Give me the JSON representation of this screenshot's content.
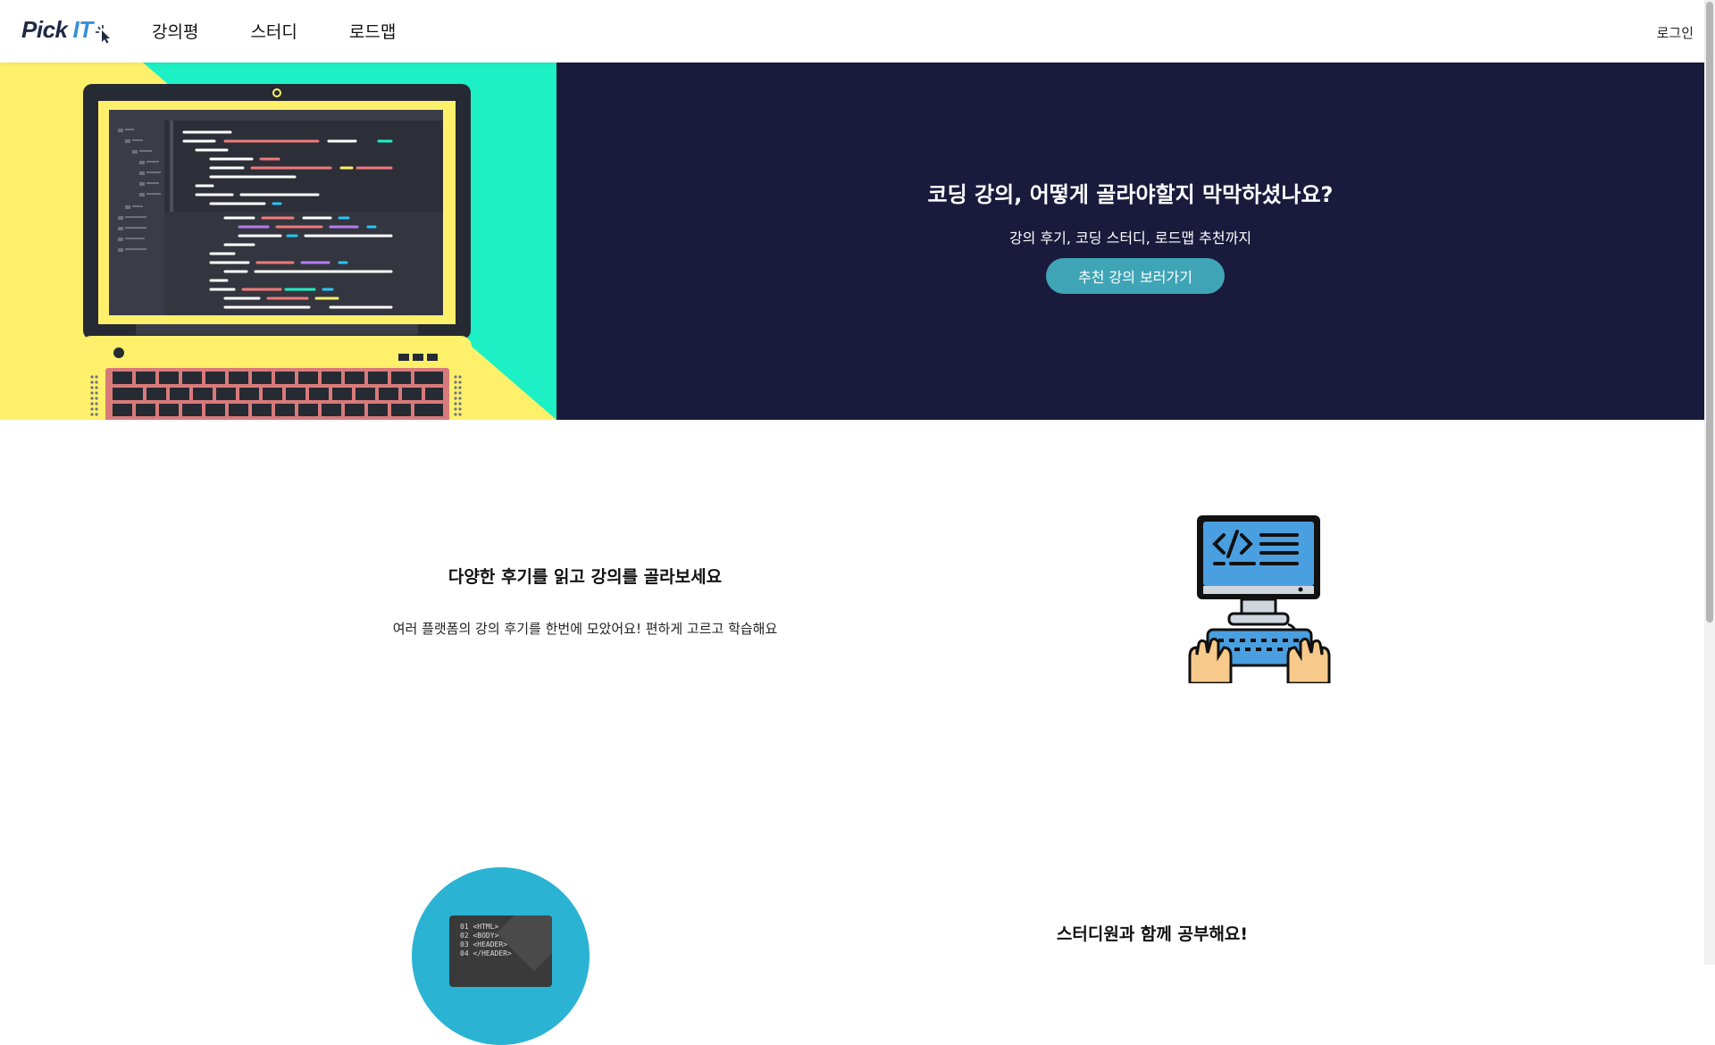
{
  "header": {
    "logo": {
      "word1": "Pick",
      "word2": "IT"
    },
    "nav": [
      "강의평",
      "스터디",
      "로드맵"
    ],
    "login": "로그인"
  },
  "hero": {
    "title": "코딩 강의, 어떻게 골라야할지 막막하셨나요?",
    "subtitle": "강의 후기, 코딩 스터디, 로드맵 추천까지",
    "cta": "추천 강의 보러가기"
  },
  "features": [
    {
      "title": "다양한 후기를 읽고 강의를 골라보세요",
      "description": "여러 플랫폼의 강의 후기를 한번에 모았어요! 편하게 고르고 학습해요",
      "icon": "coding-computer-icon"
    },
    {
      "title": "스터디원과 함께 공부해요!",
      "icon": "code-snippet-icon",
      "code_lines": [
        "01 <HTML>",
        "02 <BODY>",
        "03 <HEADER>",
        "04 </HEADER>"
      ]
    }
  ],
  "colors": {
    "hero_bg": "#1a1a3d",
    "cta_bg": "#3fa5b6",
    "hero_yellow": "#fff06c",
    "hero_mint": "#1df0c4",
    "study_circle": "#2ab3d2",
    "logo_dark": "#202a44",
    "logo_blue": "#3a8fd4"
  }
}
